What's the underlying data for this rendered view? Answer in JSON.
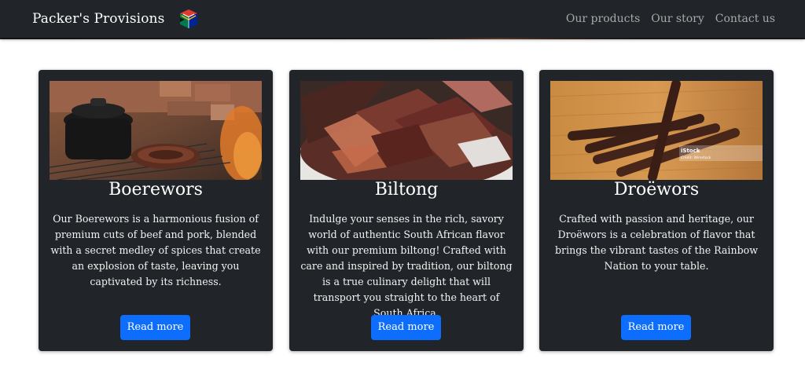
{
  "navbar": {
    "brand": "Packer's Provisions",
    "logo_icon": "south-africa-flag-cube-icon",
    "links": [
      "Our products",
      "Our story",
      "Contact us"
    ]
  },
  "cards": [
    {
      "image_icon": "boerewors-on-grill-photo",
      "title": "Boerewors",
      "text": "Our Boerewors is a harmonious fusion of premium cuts of beef and pork, blended with a secret medley of spices that create an explosion of taste, leaving you captivated by its richness.",
      "button": "Read more"
    },
    {
      "image_icon": "biltong-bowl-photo",
      "title": "Biltong",
      "text": "Indulge your senses in the rich, savory world of authentic South African flavor with our premium biltong! Crafted with care and inspired by tradition, our biltong is a true culinary delight that will transport you straight to the heart of South Africa.",
      "button": "Read more"
    },
    {
      "image_icon": "droewors-sticks-photo",
      "title": "Droëwors",
      "text": "Crafted with passion and heritage, our Droëwors is a celebration of flavor that brings the vibrant tastes of the Rainbow Nation to your table.",
      "button": "Read more",
      "watermark": {
        "line1": "iStock",
        "line2": "Credit: Wirestock"
      }
    }
  ],
  "colors": {
    "navbar": "#212529",
    "card": "#212529",
    "accent": "#0d6efd"
  }
}
